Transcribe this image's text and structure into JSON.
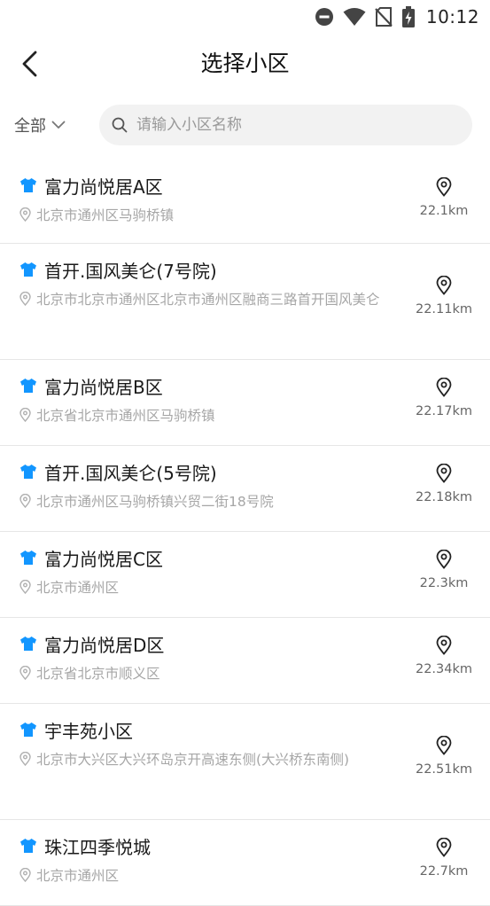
{
  "status_bar": {
    "time": "10:12"
  },
  "header": {
    "title": "选择小区"
  },
  "filter": {
    "region_label": "全部",
    "search_placeholder": "请输入小区名称",
    "search_value": ""
  },
  "communities": [
    {
      "name": "富力尚悦居A区",
      "address": "北京市通州区马驹桥镇",
      "distance": "22.1km"
    },
    {
      "name": "首开.国风美仑(7号院)",
      "address": "北京市北京市通州区北京市通州区融商三路首开国风美仑",
      "distance": "22.11km"
    },
    {
      "name": "富力尚悦居B区",
      "address": "北京省北京市通州区马驹桥镇",
      "distance": "22.17km"
    },
    {
      "name": "首开.国风美仑(5号院)",
      "address": "北京市通州区马驹桥镇兴贸二街18号院",
      "distance": "22.18km"
    },
    {
      "name": "富力尚悦居C区",
      "address": "北京市通州区",
      "distance": "22.3km"
    },
    {
      "name": "富力尚悦居D区",
      "address": "北京省北京市顺义区",
      "distance": "22.34km"
    },
    {
      "name": "宇丰苑小区",
      "address": "北京市大兴区大兴环岛京开高速东侧(大兴桥东南侧)",
      "distance": "22.51km"
    },
    {
      "name": "珠江四季悦城",
      "address": "北京市通州区",
      "distance": "22.7km"
    }
  ],
  "colors": {
    "accent": "#1296ff",
    "divider": "#e6e6e6",
    "secondary_text": "#a6a6a6"
  }
}
